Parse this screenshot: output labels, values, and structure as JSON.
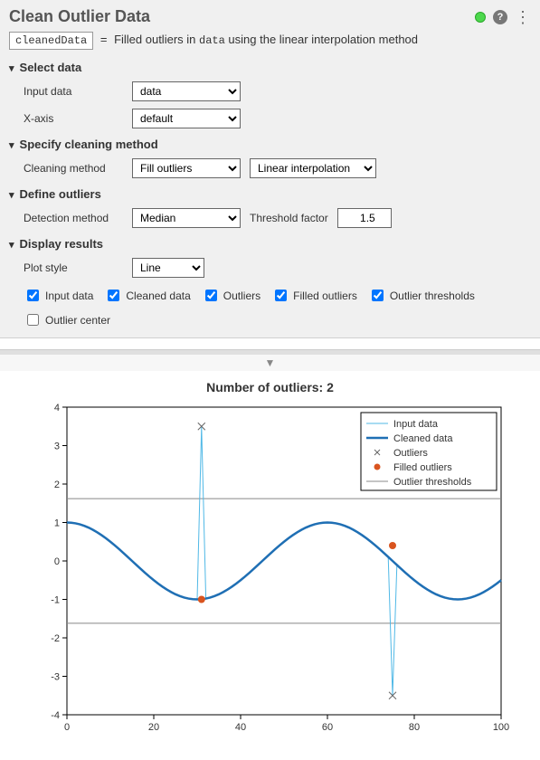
{
  "header": {
    "title": "Clean Outlier Data",
    "output_var": "cleanedData",
    "equals": " = ",
    "description_prefix": "Filled outliers in ",
    "description_data": "data",
    "description_suffix": " using the linear interpolation method"
  },
  "sections": {
    "select_data": {
      "title": "Select data",
      "input_label": "Input data",
      "input_value": "data",
      "xaxis_label": "X-axis",
      "xaxis_value": "default"
    },
    "cleaning_method": {
      "title": "Specify cleaning method",
      "label": "Cleaning method",
      "mode": "Fill outliers",
      "sub": "Linear interpolation"
    },
    "define_outliers": {
      "title": "Define outliers",
      "detect_label": "Detection method",
      "detect_value": "Median",
      "thresh_label": "Threshold factor",
      "thresh_value": "1.5"
    },
    "display": {
      "title": "Display results",
      "plot_label": "Plot style",
      "plot_value": "Line",
      "cb_input": "Input data",
      "cb_cleaned": "Cleaned data",
      "cb_outliers": "Outliers",
      "cb_filled": "Filled outliers",
      "cb_thresh": "Outlier thresholds",
      "cb_center": "Outlier center"
    }
  },
  "chart_data": {
    "type": "line",
    "title": "Number of outliers: 2",
    "xlabel": "",
    "ylabel": "",
    "xlim": [
      0,
      100
    ],
    "ylim": [
      -4,
      4
    ],
    "xticks": [
      0,
      20,
      40,
      60,
      80,
      100
    ],
    "yticks": [
      -4,
      -3,
      -2,
      -1,
      0,
      1,
      2,
      3,
      4
    ],
    "thresholds": [
      1.62,
      -1.62
    ],
    "outliers": [
      {
        "x": 31,
        "y": 3.5
      },
      {
        "x": 75,
        "y": -3.5
      }
    ],
    "filled": [
      {
        "x": 31,
        "y": -1.0
      },
      {
        "x": 75,
        "y": 0.4
      }
    ],
    "legend": [
      "Input data",
      "Cleaned data",
      "Outliers",
      "Filled outliers",
      "Outlier thresholds"
    ]
  }
}
